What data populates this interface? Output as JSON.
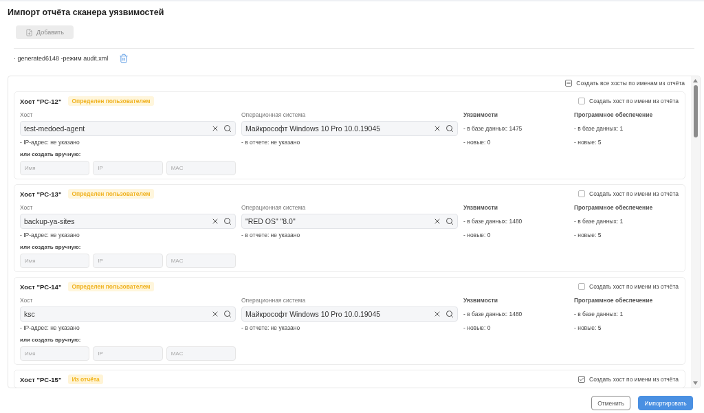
{
  "title": "Импорт отчёта сканера уязвимостей",
  "add_button": {
    "label": "Добавить",
    "disabled": true
  },
  "files": [
    {
      "name": "· generated6148 -режим audit.xml"
    }
  ],
  "create_all": {
    "label": "Создать все хосты по именам из отчёта",
    "indeterminate": true
  },
  "hosts": [
    {
      "title": "Хост \"PC-12\"",
      "badge": {
        "label": "Определен пользователем",
        "kind": "user"
      },
      "create_by_name": {
        "label": "Создать хост по имени из отчёта",
        "checked": false
      },
      "host_label": "Хост",
      "host_value": "test-medoed-agent",
      "ip_note": "- IP-адрес: не указано",
      "manual_label": "или создать вручную:",
      "manual_fields": [
        {
          "placeholder": "Имя"
        },
        {
          "placeholder": "IP"
        },
        {
          "placeholder": "MAC"
        }
      ],
      "os_label": "Операционная система",
      "os_value": "Майкрософт Windows 10 Pro 10.0.19045",
      "os_note": "- в отчете: не указано",
      "vuln_label": "Уязвимости",
      "vuln_lines": [
        "- в базе данных: 1475",
        "- новые: 0"
      ],
      "software_label": "Программное обеспечение",
      "software_lines": [
        "- в базе данных: 1",
        "- новые: 5"
      ]
    },
    {
      "title": "Хост \"PC-13\"",
      "badge": {
        "label": "Определен пользователем",
        "kind": "user"
      },
      "create_by_name": {
        "label": "Создать хост по имени из отчёта",
        "checked": false
      },
      "host_label": "Хост",
      "host_value": "backup-ya-sites",
      "ip_note": "- IP-адрес: не указано",
      "manual_label": "или создать вручную:",
      "manual_fields": [
        {
          "placeholder": "Имя"
        },
        {
          "placeholder": "IP"
        },
        {
          "placeholder": "MAC"
        }
      ],
      "os_label": "Операционная система",
      "os_value": "\"RED OS\" \"8.0\"",
      "os_note": "- в отчете: не указано",
      "vuln_label": "Уязвимости",
      "vuln_lines": [
        "- в базе данных: 1480",
        "- новые: 0"
      ],
      "software_label": "Программное обеспечение",
      "software_lines": [
        "- в базе данных: 1",
        "- новые: 5"
      ]
    },
    {
      "title": "Хост \"PC-14\"",
      "badge": {
        "label": "Определен пользователем",
        "kind": "user"
      },
      "create_by_name": {
        "label": "Создать хост по имени из отчёта",
        "checked": false
      },
      "host_label": "Хост",
      "host_value": "ksc",
      "ip_note": "- IP-адрес: не указано",
      "manual_label": "или создать вручную:",
      "manual_fields": [
        {
          "placeholder": "Имя"
        },
        {
          "placeholder": "IP"
        },
        {
          "placeholder": "MAC"
        }
      ],
      "os_label": "Операционная система",
      "os_value": "Майкрософт Windows 10 Pro 10.0.19045",
      "os_note": "- в отчете: не указано",
      "vuln_label": "Уязвимости",
      "vuln_lines": [
        "- в базе данных: 1480",
        "- новые: 0"
      ],
      "software_label": "Программное обеспечение",
      "software_lines": [
        "- в базе данных: 1",
        "- новые: 5"
      ]
    },
    {
      "title": "Хост \"PC-15\"",
      "badge": {
        "label": "Из отчёта",
        "kind": "report"
      },
      "create_by_name": {
        "label": "Создать хост по имени из отчёта",
        "checked": true
      }
    }
  ],
  "footer_buttons": [
    {
      "label": "Отменить",
      "kind": "secondary"
    },
    {
      "label": "Импортировать",
      "kind": "primary"
    }
  ]
}
